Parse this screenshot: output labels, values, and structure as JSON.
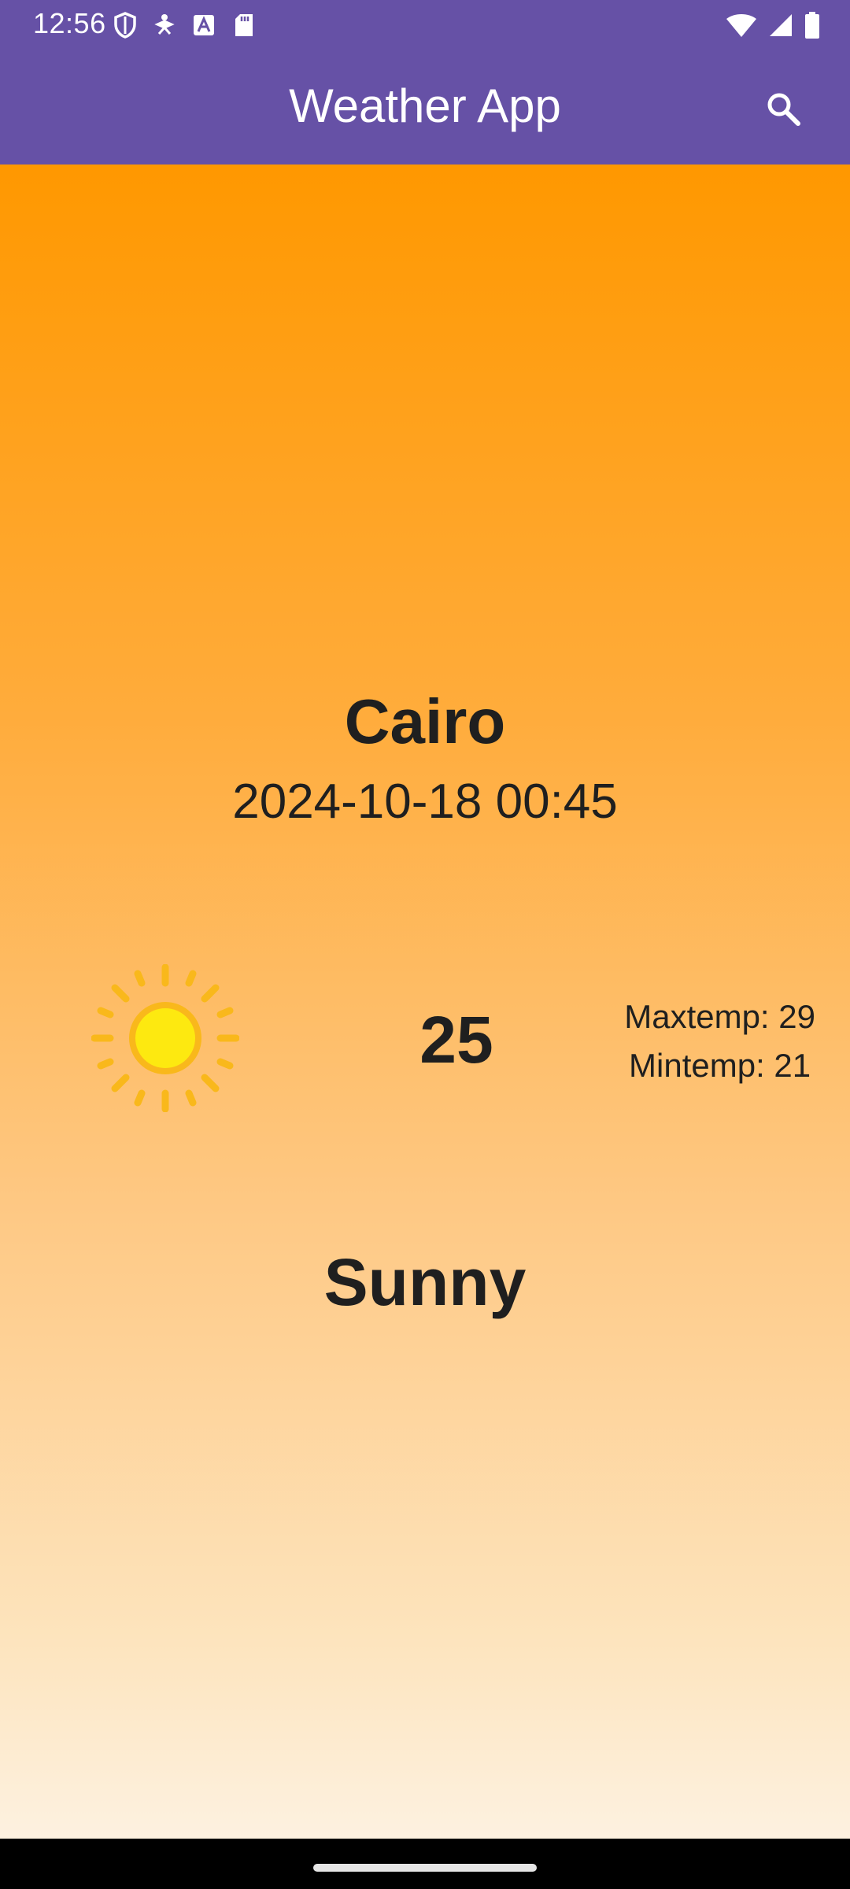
{
  "status_bar": {
    "time": "12:56",
    "left_icons": [
      "shield-icon",
      "accessibility-icon",
      "text-a-icon",
      "sd-card-icon"
    ],
    "right_icons": [
      "wifi-icon",
      "signal-icon",
      "battery-icon"
    ]
  },
  "app_bar": {
    "title": "Weather App",
    "search_icon": "search-icon",
    "color": "#6651a6"
  },
  "weather": {
    "city": "Cairo",
    "datetime": "2024-10-18 00:45",
    "temperature": "25",
    "max_temp": "Maxtemp: 29",
    "min_temp": "Mintemp: 21",
    "condition": "Sunny",
    "condition_icon": "sun-icon",
    "gradient_top": "#ff9800",
    "gradient_bottom": "#fdf1e0"
  }
}
